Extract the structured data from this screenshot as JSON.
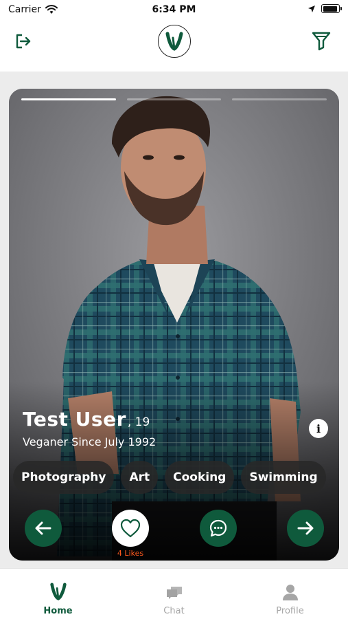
{
  "status_bar": {
    "carrier": "Carrier",
    "time": "6:34 PM",
    "battery_level": 0.95
  },
  "header": {
    "logout_icon": "logout-icon",
    "logo_icon": "vegan-v-logo",
    "filter_icon": "filter-funnel-icon"
  },
  "card": {
    "photo_progress": {
      "total": 3,
      "current": 1
    },
    "name": "Test User",
    "age": ", 19",
    "subtitle": "Veganer Since July 1992",
    "tags": [
      "Photography",
      "Art",
      "Cooking",
      "Swimming"
    ],
    "likes_label": "4 Likes"
  },
  "tabs": [
    {
      "label": "Home",
      "icon": "home-v-icon",
      "active": true
    },
    {
      "label": "Chat",
      "icon": "chat-bubbles-icon",
      "active": false
    },
    {
      "label": "Profile",
      "icon": "person-icon",
      "active": false
    }
  ],
  "colors": {
    "brand_green": "#0f5a3c",
    "likes_orange": "#ff5a1f",
    "inactive_tab": "#a6a6a6"
  }
}
